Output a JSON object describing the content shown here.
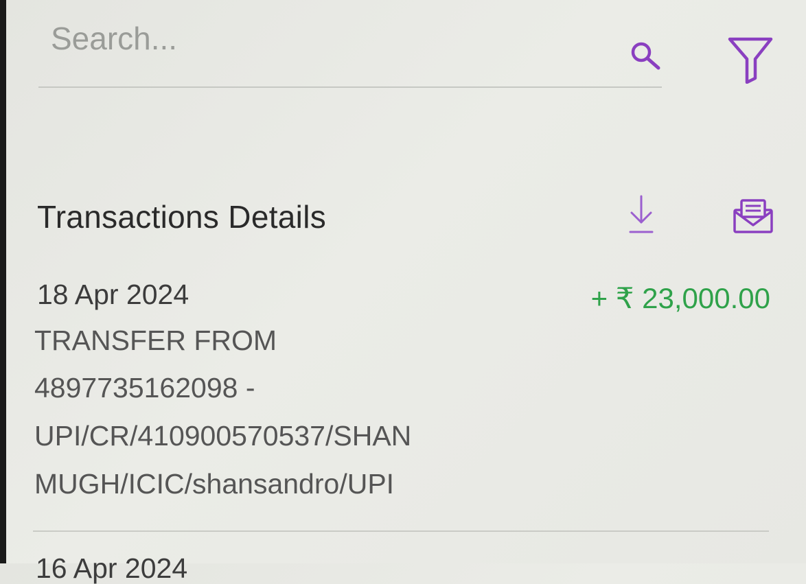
{
  "search": {
    "placeholder": "Search...",
    "value": ""
  },
  "icons": {
    "search": "search-icon",
    "filter": "filter-icon",
    "download": "download-icon",
    "email": "email-icon"
  },
  "colors": {
    "accent": "#8a3fc0",
    "credit": "#2fa24a",
    "text_primary": "#2a2a2a",
    "text_secondary": "#555555"
  },
  "section": {
    "title": "Transactions Details"
  },
  "transactions": [
    {
      "date": "18 Apr 2024",
      "amount": "+ ₹  23,000.00",
      "description_lines": [
        "TRANSFER FROM",
        "4897735162098 -",
        "UPI/CR/410900570537/SHAN",
        "MUGH/ICIC/shansandro/UPI"
      ]
    },
    {
      "date": "16 Apr 2024"
    }
  ]
}
